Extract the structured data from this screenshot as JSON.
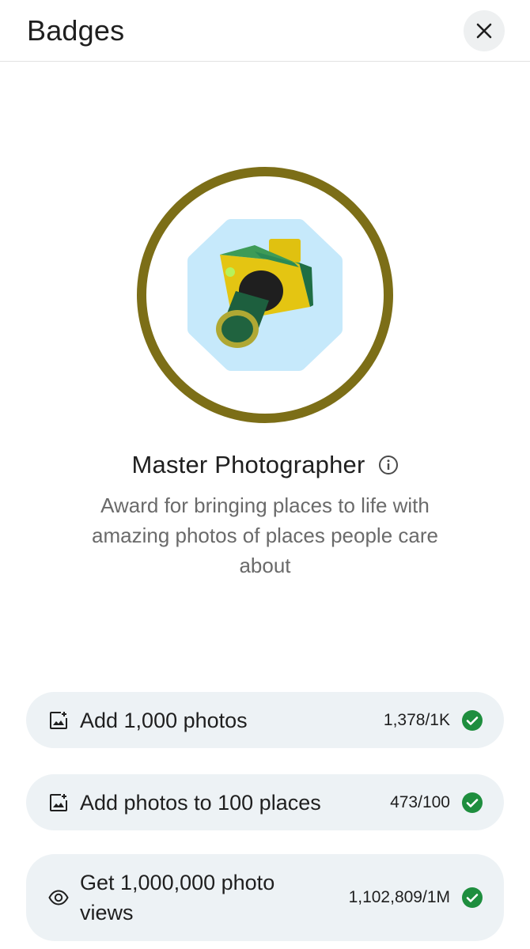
{
  "header": {
    "title": "Badges",
    "close_icon": "close-icon"
  },
  "badge": {
    "name": "Master Photographer",
    "description": "Award for bringing places to life with amazing photos of places people care about",
    "icon": "camera-icon",
    "ring_color": "#7c6e17",
    "bg_color": "#c6e9fb"
  },
  "tasks": [
    {
      "label": "Add 1,000 photos",
      "progress": "1,378/1K",
      "icon": "add-photo-icon",
      "completed": true
    },
    {
      "label": "Add photos to 100 places",
      "progress": "473/100",
      "icon": "add-photo-icon",
      "completed": true
    },
    {
      "label": "Get 1,000,000 photo views",
      "progress": "1,102,809/1M",
      "icon": "eye-icon",
      "completed": true
    }
  ],
  "colors": {
    "check": "#1e8e3e",
    "task_bg": "#edf2f5"
  }
}
